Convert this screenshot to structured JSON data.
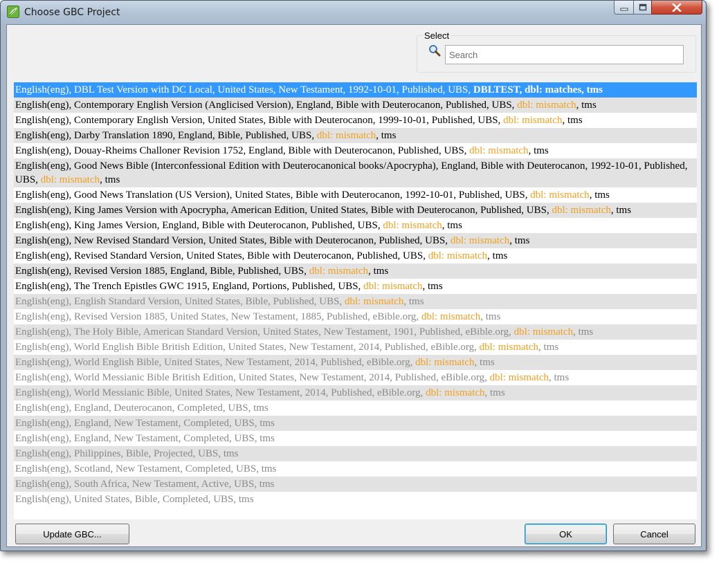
{
  "window": {
    "title": "Choose GBC Project",
    "colors": {
      "titlebar": "#b3c3d6",
      "close": "#c4402a",
      "selection": "#3399ff",
      "dbl_mismatch": "#f0a020"
    }
  },
  "select": {
    "label": "Select",
    "search_placeholder": "Search"
  },
  "projects": [
    {
      "text": "English(eng), DBL Test Version with DC Local, United States, New Testament, 1992-10-01, Published, UBS, ",
      "tail": "DBLTEST, dbl: matches, tms",
      "state": "selected"
    },
    {
      "text": "English(eng), Contemporary English Version (Anglicised Version), England, Bible with Deuterocanon, Published, UBS, ",
      "dbl": "dbl: mismatch",
      "suffix": ", tms",
      "state": "normal"
    },
    {
      "text": "English(eng), Contemporary English Version, United States, Bible with Deuterocanon, 1999-10-01, Published, UBS, ",
      "dbl": "dbl: mismatch",
      "suffix": ", tms",
      "state": "normal"
    },
    {
      "text": "English(eng), Darby Translation 1890, England, Bible, Published, UBS, ",
      "dbl": "dbl: mismatch",
      "suffix": ", tms",
      "state": "normal"
    },
    {
      "text": "English(eng), Douay-Rheims Challoner Revision 1752, England, Bible with Deuterocanon, Published, UBS, ",
      "dbl": "dbl: mismatch",
      "suffix": ", tms",
      "state": "normal"
    },
    {
      "text": "English(eng), Good News Bible (Interconfessional Edition with Deuterocanonical books/Apocrypha), England, Bible with Deuterocanon, 1992-10-01, Published, UBS, ",
      "dbl": "dbl: mismatch",
      "suffix": ", tms",
      "state": "normal"
    },
    {
      "text": "English(eng), Good News Translation (US Version), United States, Bible with Deuterocanon, 1992-10-01, Published, UBS, ",
      "dbl": "dbl: mismatch",
      "suffix": ", tms",
      "state": "normal"
    },
    {
      "text": "English(eng), King James Version with Apocrypha, American Edition, United States, Bible with Deuterocanon, Published, UBS, ",
      "dbl": "dbl: mismatch",
      "suffix": ", tms",
      "state": "normal"
    },
    {
      "text": "English(eng), King James Version, England, Bible with Deuterocanon, Published, UBS, ",
      "dbl": "dbl: mismatch",
      "suffix": ", tms",
      "state": "normal"
    },
    {
      "text": "English(eng), New Revised Standard Version, United States, Bible with Deuterocanon, Published, UBS, ",
      "dbl": "dbl: mismatch",
      "suffix": ", tms",
      "state": "normal"
    },
    {
      "text": "English(eng), Revised Standard Version, United States, Bible with Deuterocanon, Published, UBS, ",
      "dbl": "dbl: mismatch",
      "suffix": ", tms",
      "state": "normal"
    },
    {
      "text": "English(eng), Revised Version 1885, England, Bible, Published, UBS, ",
      "dbl": "dbl: mismatch",
      "suffix": ", tms",
      "state": "normal"
    },
    {
      "text": "English(eng), The Trench Epistles GWC 1915, England, Portions, Published, UBS, ",
      "dbl": "dbl: mismatch",
      "suffix": ", tms",
      "state": "normal"
    },
    {
      "text": "English(eng), English Standard Version, United States, Bible, Published, UBS, ",
      "dbl": "dbl: mismatch",
      "suffix": ", tms",
      "state": "disabled"
    },
    {
      "text": "English(eng), Revised Version 1885, United States, New Testament, 1885, Published, eBible.org, ",
      "dbl": "dbl: mismatch",
      "suffix": ", tms",
      "state": "disabled"
    },
    {
      "text": "English(eng), The Holy Bible, American Standard Version, United States, New Testament, 1901, Published, eBible.org, ",
      "dbl": "dbl: mismatch",
      "suffix": ", tms",
      "state": "disabled"
    },
    {
      "text": "English(eng), World English Bible British Edition, United States, New Testament, 2014, Published, eBible.org, ",
      "dbl": "dbl: mismatch",
      "suffix": ", tms",
      "state": "disabled"
    },
    {
      "text": "English(eng), World English Bible, United States, New Testament, 2014, Published, eBible.org, ",
      "dbl": "dbl: mismatch",
      "suffix": ", tms",
      "state": "disabled"
    },
    {
      "text": "English(eng), World Messianic Bible British Edition, United States, New Testament, 2014, Published, eBible.org, ",
      "dbl": "dbl: mismatch",
      "suffix": ", tms",
      "state": "disabled"
    },
    {
      "text": "English(eng), World Messianic Bible, United States, New Testament, 2014, Published, eBible.org, ",
      "dbl": "dbl: mismatch",
      "suffix": ", tms",
      "state": "disabled"
    },
    {
      "text": "English(eng), England, Deuterocanon, Completed, UBS, tms",
      "state": "disabled"
    },
    {
      "text": "English(eng), England, New Testament, Completed, UBS, tms",
      "state": "disabled"
    },
    {
      "text": "English(eng), England, New Testament, Completed, UBS, tms",
      "state": "disabled"
    },
    {
      "text": "English(eng), Philippines, Bible, Projected, UBS, tms",
      "state": "disabled"
    },
    {
      "text": "English(eng), Scotland, New Testament, Completed, UBS, tms",
      "state": "disabled"
    },
    {
      "text": "English(eng), South Africa, New Testament, Active, UBS, tms",
      "state": "disabled"
    },
    {
      "text": "English(eng), United States, Bible, Completed, UBS, tms",
      "state": "disabled"
    }
  ],
  "buttons": {
    "update": "Update GBC...",
    "ok": "OK",
    "cancel": "Cancel"
  },
  "icons": {
    "app": "leaf-icon",
    "search": "magnifier-icon",
    "minimize": "minimize-icon",
    "maximize": "maximize-icon",
    "close": "close-icon"
  }
}
